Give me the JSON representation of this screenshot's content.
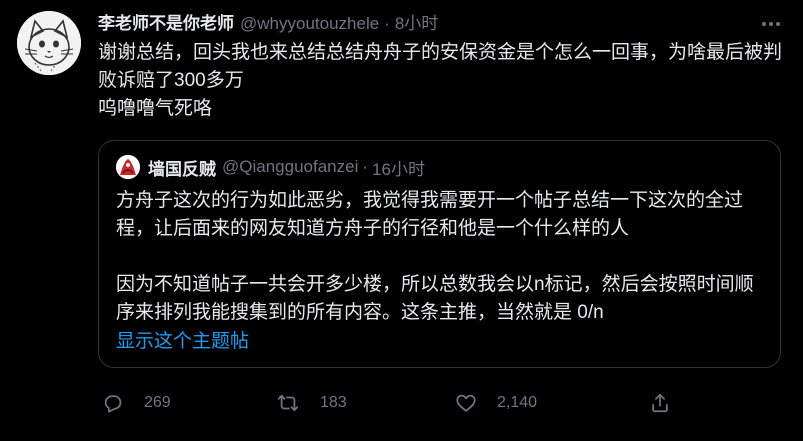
{
  "author": {
    "display_name": "李老师不是你老师",
    "handle": "@whyyoutouzhele",
    "time": "8小时"
  },
  "tweet": {
    "lines": [
      "谢谢总结，回头我也来总结总结舟舟子的安保资金是个怎么一回事，为啥最后被判败诉赔了300多万",
      "呜噜噜气死咯"
    ]
  },
  "quoted": {
    "display_name": "墙国反贼",
    "handle": "@Qiangguofanzei",
    "time": "16小时",
    "paragraphs": [
      "方舟子这次的行为如此恶劣，我觉得我需要开一个帖子总结一下这次的全过程，让后面来的网友知道方舟子的行径和他是一个什么样的人",
      "因为不知道帖子一共会开多少楼，所以总数我会以n标记，然后会按照时间顺序来排列我能搜集到的所有内容。这条主推，当然就是 0/n"
    ],
    "show_thread_label": "显示这个主题帖"
  },
  "separator": "·",
  "actions": {
    "reply_count": "269",
    "retweet_count": "183",
    "like_count": "2,140"
  },
  "icons": {
    "more": "more-horizontal-icon",
    "reply": "reply-icon",
    "retweet": "retweet-icon",
    "like": "heart-icon",
    "share": "share-icon"
  },
  "colors": {
    "background": "#000000",
    "text": "#e7e9ea",
    "secondary": "#71767b",
    "link": "#1d9bf0",
    "border": "#2f3336"
  }
}
